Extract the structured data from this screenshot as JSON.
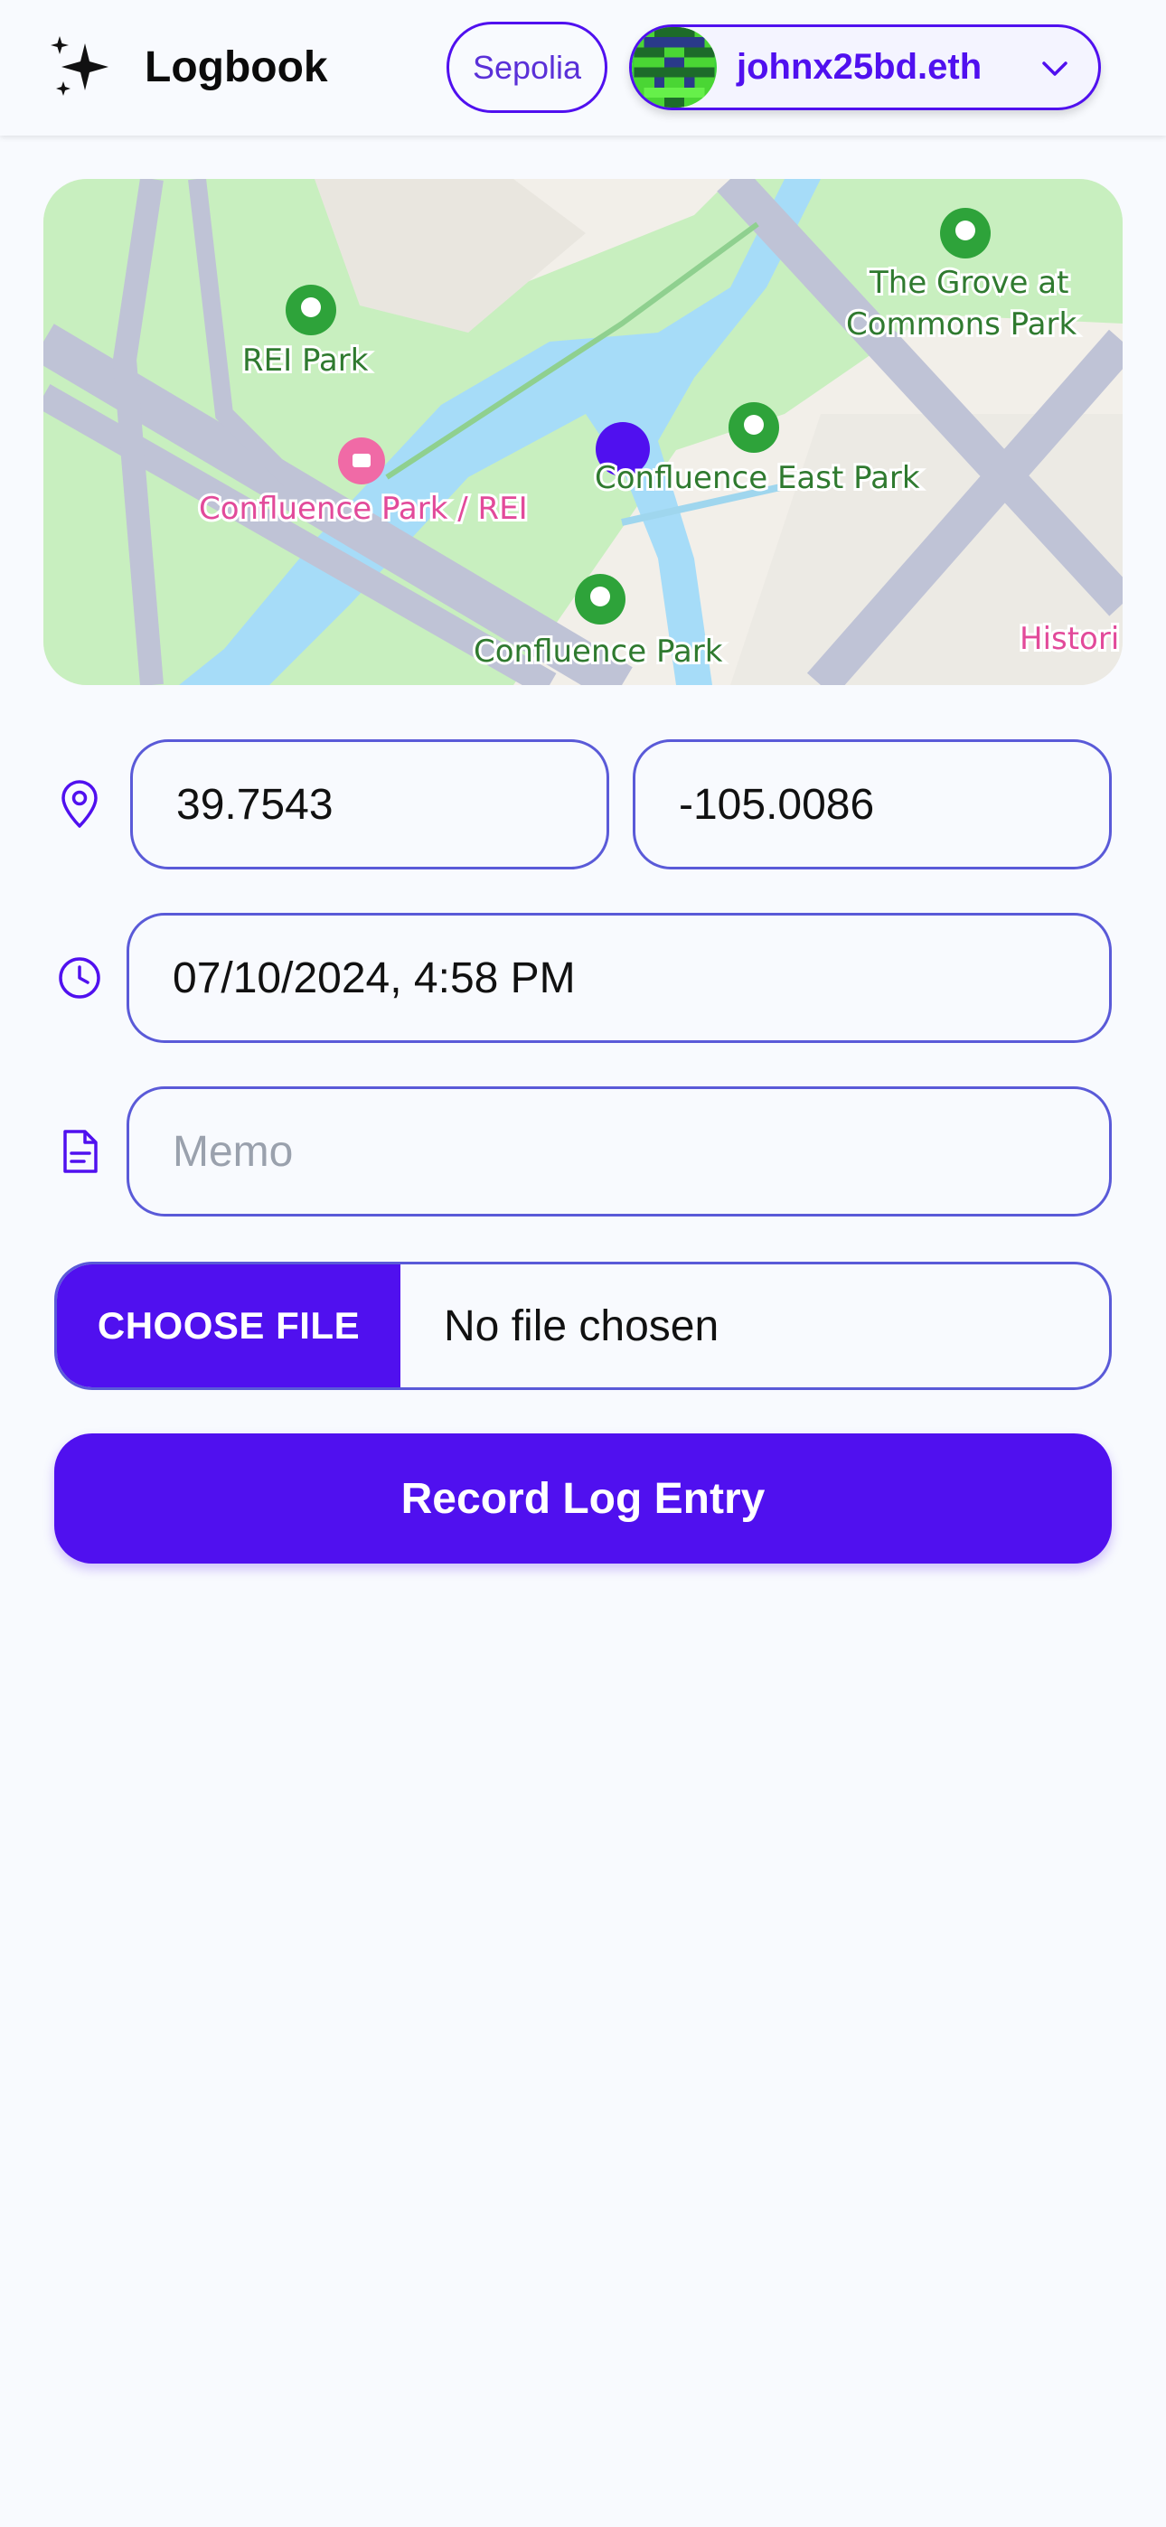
{
  "app": {
    "title": "Logbook",
    "logo_icon": "sparkles-icon"
  },
  "header": {
    "network_label": "Sepolia",
    "account_name": "johnx25bd.eth",
    "account_menu_icon": "chevron-down-icon"
  },
  "map": {
    "labels": {
      "rei_park": "REI Park",
      "confluence_park_rei": "Confluence Park / REI",
      "confluence_east_park": "Confluence East Park",
      "confluence_park": "Confluence Park",
      "grove_line1": "The Grove at",
      "grove_line2": "Commons Park",
      "historic": "Histori"
    },
    "marker_color": "#5010ef",
    "water_color": "#a6dcf8",
    "park_color": "#c8efbf"
  },
  "form": {
    "latitude": "39.7543",
    "longitude": "-105.0086",
    "datetime": "07/10/2024, 4:58 PM",
    "memo_placeholder": "Memo",
    "file_button_label": "CHOOSE FILE",
    "file_status": "No file chosen",
    "submit_label": "Record Log Entry",
    "icons": {
      "location": "map-pin-icon",
      "time": "clock-icon",
      "memo": "document-icon"
    }
  },
  "colors": {
    "accent": "#5010ef",
    "field_border": "#5a5ad8",
    "background": "#f8fafe"
  }
}
